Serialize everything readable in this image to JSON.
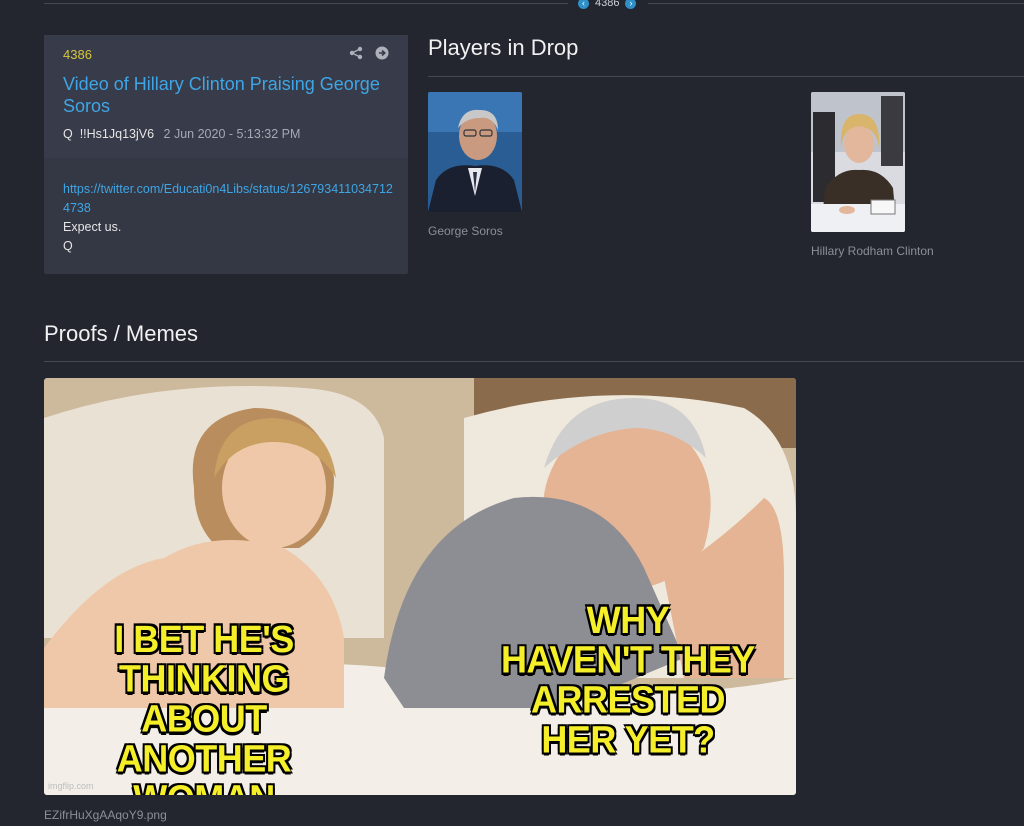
{
  "nav": {
    "post_number": "4386",
    "prev_icon": "chevron-left-icon",
    "next_icon": "chevron-right-icon"
  },
  "post": {
    "number": "4386",
    "title": "Video of Hillary Clinton Praising George Soros",
    "author": "Q",
    "tripcode": "!!Hs1Jq13jV6",
    "timestamp": "2 Jun 2020 - 5:13:32 PM",
    "link": "https://twitter.com/Educati0n4Libs/status/1267934110347124738",
    "lines": [
      "Expect us.",
      "Q"
    ],
    "share_icon": "share-icon",
    "goto_icon": "arrow-circle-right-icon"
  },
  "players": {
    "title": "Players in Drop",
    "people": [
      {
        "name": "George Soros"
      },
      {
        "name": "Hillary Rodham Clinton"
      }
    ]
  },
  "proofs": {
    "title": "Proofs / Memes",
    "meme": {
      "left_text": [
        "I BET HE'S",
        "THINKING ABOUT",
        "ANOTHER WOMAN"
      ],
      "right_text": [
        "WHY",
        "HAVEN'T THEY",
        "ARRESTED",
        "HER YET?"
      ],
      "watermark": "imgflip.com"
    },
    "filename": "EZifrHuXgAAqoY9.png"
  },
  "colors": {
    "background": "#23252f",
    "card": "#343744",
    "link": "#3ea6e6",
    "post_number": "#d6c63b",
    "meme_text": "#f5ef2a"
  }
}
